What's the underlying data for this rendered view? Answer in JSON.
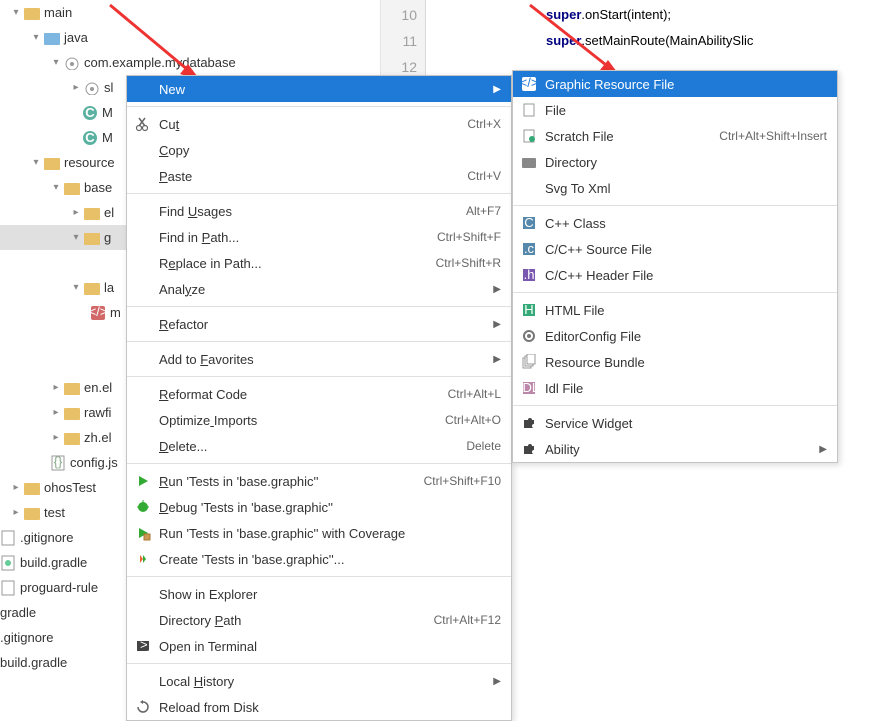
{
  "tree": {
    "main": "main",
    "java": "java",
    "pkg": "com.example.mydatabase",
    "slice": "sl",
    "classM1": "M",
    "classM2": "M",
    "resources": "resource",
    "base": "base",
    "el": "el",
    "g": "g",
    "la": "la",
    "m": "m",
    "en": "en.el",
    "rawfi": "rawfi",
    "zh": "zh.el",
    "config": "config.js",
    "ohosTest": "ohosTest",
    "test": "test",
    "gitignore": ".gitignore",
    "buildgradle": "build.gradle",
    "proguard": "proguard-rule",
    "gradle": "gradle",
    "gitignore2": ".gitignore",
    "buildgradle2": "build.gradle"
  },
  "gutter": {
    "l10": "10",
    "l11": "11",
    "l12": "12"
  },
  "code": {
    "kw": "super",
    "onStart": ".onStart(intent);",
    "setMain": ".setMainRoute(MainAbilitySlic"
  },
  "menu1": [
    {
      "key": "new",
      "label": "New",
      "shortcut": "",
      "arrow": true,
      "hl": true
    },
    {
      "sep": true
    },
    {
      "key": "cut",
      "label": "Cut",
      "u": 2,
      "shortcut": "Ctrl+X",
      "icon": "cut"
    },
    {
      "key": "copy",
      "label": "Copy",
      "u": 0,
      "shortcut": ""
    },
    {
      "key": "paste",
      "label": "Paste",
      "u": 0,
      "shortcut": "Ctrl+V"
    },
    {
      "sep": true
    },
    {
      "key": "findu",
      "label": "Find Usages",
      "u": 5,
      "shortcut": "Alt+F7"
    },
    {
      "key": "findp",
      "label": "Find in Path...",
      "u": 8,
      "shortcut": "Ctrl+Shift+F"
    },
    {
      "key": "repp",
      "label": "Replace in Path...",
      "u": 1,
      "shortcut": "Ctrl+Shift+R"
    },
    {
      "key": "analyze",
      "label": "Analyze",
      "u": 4,
      "shortcut": "",
      "arrow": true
    },
    {
      "sep": true
    },
    {
      "key": "refactor",
      "label": "Refactor",
      "u": 0,
      "shortcut": "",
      "arrow": true
    },
    {
      "sep": true
    },
    {
      "key": "fav",
      "label": "Add to Favorites",
      "u": 7,
      "shortcut": "",
      "arrow": true
    },
    {
      "sep": true
    },
    {
      "key": "reformat",
      "label": "Reformat Code",
      "u": 0,
      "shortcut": "Ctrl+Alt+L"
    },
    {
      "key": "optim",
      "label": "Optimize Imports",
      "u": 8,
      "shortcut": "Ctrl+Alt+O"
    },
    {
      "key": "del",
      "label": "Delete...",
      "u": 0,
      "shortcut": "Delete"
    },
    {
      "sep": true
    },
    {
      "key": "run",
      "label": "Run 'Tests in 'base.graphic''",
      "u": 0,
      "shortcut": "Ctrl+Shift+F10",
      "icon": "run"
    },
    {
      "key": "debug",
      "label": "Debug 'Tests in 'base.graphic''",
      "u": 0,
      "icon": "debug"
    },
    {
      "key": "cov",
      "label": "Run 'Tests in 'base.graphic'' with Coverage",
      "icon": "coverage"
    },
    {
      "key": "create",
      "label": "Create 'Tests in 'base.graphic''...",
      "icon": "create"
    },
    {
      "sep": true
    },
    {
      "key": "expl",
      "label": "Show in Explorer"
    },
    {
      "key": "dirp",
      "label": "Directory Path",
      "u": 10,
      "shortcut": "Ctrl+Alt+F12"
    },
    {
      "key": "term",
      "label": "Open in Terminal",
      "icon": "term"
    },
    {
      "sep": true
    },
    {
      "key": "hist",
      "label": "Local History",
      "u": 6,
      "shortcut": "",
      "arrow": true
    },
    {
      "key": "reload",
      "label": "Reload from Disk",
      "icon": "reload"
    }
  ],
  "menu2": [
    {
      "key": "grf",
      "label": "Graphic Resource File",
      "icon": "xml",
      "hl": true
    },
    {
      "key": "file",
      "label": "File",
      "icon": "file"
    },
    {
      "key": "scratch",
      "label": "Scratch File",
      "icon": "scratch",
      "shortcut": "Ctrl+Alt+Shift+Insert"
    },
    {
      "key": "dir",
      "label": "Directory",
      "icon": "folder"
    },
    {
      "key": "svgxml",
      "label": "Svg To Xml"
    },
    {
      "sep": true
    },
    {
      "key": "cppc",
      "label": "C++ Class",
      "icon": "cpp"
    },
    {
      "key": "ccsrc",
      "label": "C/C++ Source File",
      "icon": "cppf"
    },
    {
      "key": "cchdr",
      "label": "C/C++ Header File",
      "icon": "cpph"
    },
    {
      "sep": true
    },
    {
      "key": "html",
      "label": "HTML File",
      "icon": "html"
    },
    {
      "key": "edcfg",
      "label": "EditorConfig File",
      "icon": "gear"
    },
    {
      "key": "resb",
      "label": "Resource Bundle",
      "icon": "bundle"
    },
    {
      "key": "idl",
      "label": "Idl File",
      "icon": "idl"
    },
    {
      "sep": true
    },
    {
      "key": "svcw",
      "label": "Service Widget",
      "icon": "puzzle"
    },
    {
      "key": "abil",
      "label": "Ability",
      "icon": "puzzle",
      "arrow": true
    }
  ]
}
